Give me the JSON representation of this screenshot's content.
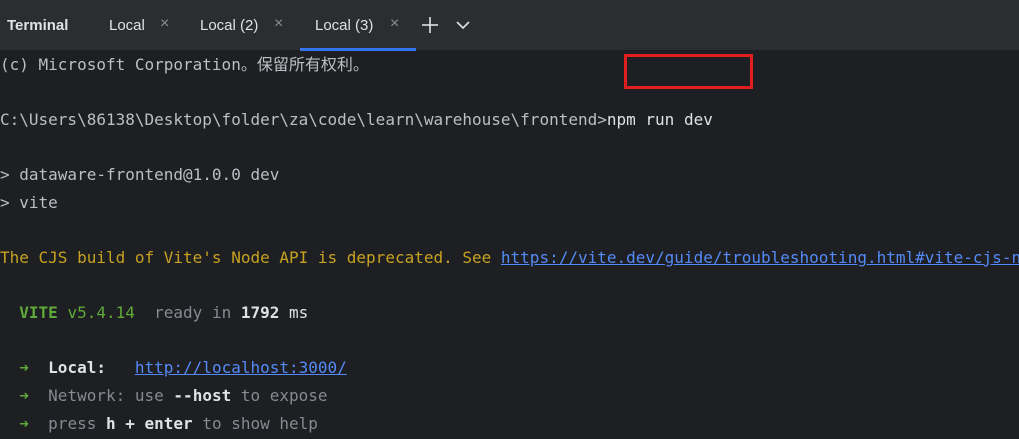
{
  "tabbar": {
    "title": "Terminal",
    "tabs": [
      {
        "label": "Local",
        "close": "×"
      },
      {
        "label": "Local (2)",
        "close": "×"
      },
      {
        "label": "Local (3)",
        "close": "×"
      }
    ],
    "active_tab": 2,
    "new_tab_icon": "plus-icon",
    "dropdown_icon": "chevron-down-icon"
  },
  "terminal": {
    "copyright": "(c) Microsoft Corporation。保留所有权利。",
    "prompt_path": "C:\\Users\\86138\\Desktop\\folder\\za\\code\\learn\\warehouse\\frontend>",
    "command": "npm run dev",
    "script_line1": "> dataware-frontend@1.0.0 dev",
    "script_line2": "> vite",
    "warning_text": "The CJS build of Vite's Node API is deprecated. See ",
    "warning_link": "https://vite.dev/guide/troubleshooting.html#vite-cjs-node-api-deprecated",
    "vite_name": "VITE",
    "vite_version": "v5.4.14",
    "ready_text": "ready in",
    "ready_ms": "1792",
    "ms_unit": "ms",
    "arrow": "➜",
    "local_label": "Local:",
    "local_url": "http://localhost:3000/",
    "network_label": "Network:",
    "network_use": "use",
    "network_flag": "--host",
    "network_tail": "to expose",
    "press_text": "press",
    "press_key": "h + enter",
    "press_tail": "to show help"
  },
  "colors": {
    "tabbar_bg": "#2b2d30",
    "terminal_bg": "#1e1f22",
    "accent": "#3574f0",
    "warning": "#c7a221",
    "vite_green": "#5faa3a",
    "link": "#548af7",
    "highlight_box": "#e31e1e"
  }
}
